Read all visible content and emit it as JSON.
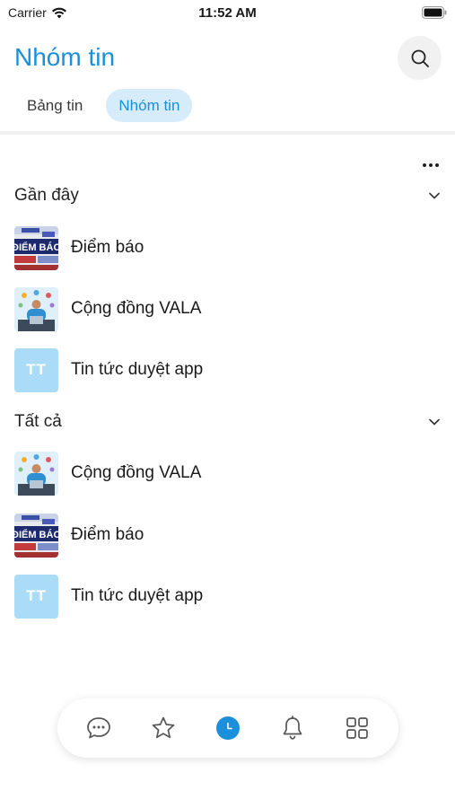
{
  "status_bar": {
    "carrier": "Carrier",
    "time": "11:52 AM"
  },
  "header": {
    "title": "Nhóm tin"
  },
  "tabs": [
    {
      "label": "Bảng tin",
      "active": false
    },
    {
      "label": "Nhóm tin",
      "active": true
    }
  ],
  "sections": {
    "recent": {
      "title": "Gần đây",
      "items": [
        {
          "name": "Điểm báo",
          "thumb": "diem-bao"
        },
        {
          "name": "Cộng đồng VALA",
          "thumb": "vala"
        },
        {
          "name": "Tin tức duyệt app",
          "thumb": "tt"
        }
      ]
    },
    "all": {
      "title": "Tất cả",
      "items": [
        {
          "name": "Cộng đồng VALA",
          "thumb": "vala"
        },
        {
          "name": "Điểm báo",
          "thumb": "diem-bao"
        },
        {
          "name": "Tin tức duyệt app",
          "thumb": "tt"
        }
      ]
    }
  },
  "thumb_text": {
    "tt": "TT",
    "diem_bao": "ĐIỂM BÁO"
  },
  "bottom_nav": [
    {
      "icon": "chat-icon",
      "active": false
    },
    {
      "icon": "star-icon",
      "active": false
    },
    {
      "icon": "clock-icon",
      "active": true
    },
    {
      "icon": "bell-icon",
      "active": false
    },
    {
      "icon": "grid-icon",
      "active": false
    }
  ],
  "colors": {
    "accent": "#1a8fdc",
    "tab_active_bg": "#d6ecfb",
    "tt_thumb": "#aadcf8"
  }
}
